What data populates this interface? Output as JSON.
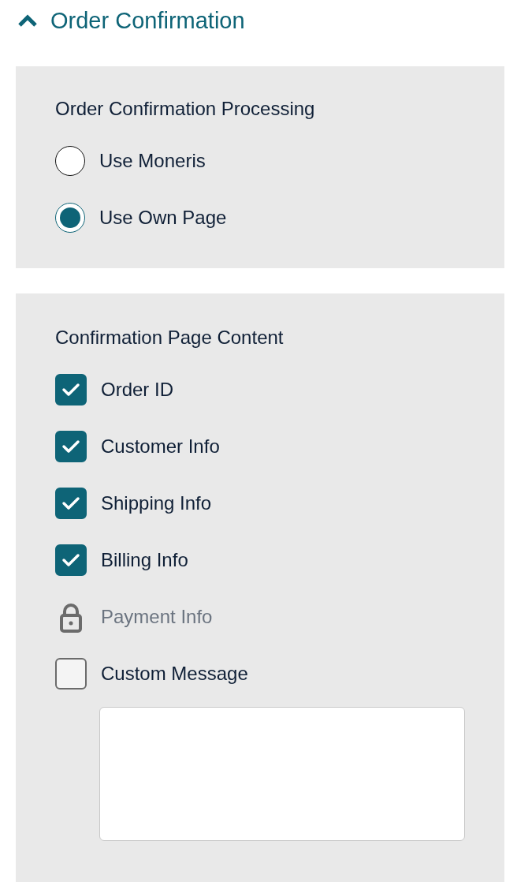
{
  "section": {
    "title": "Order Confirmation",
    "expanded": true
  },
  "processing": {
    "title": "Order Confirmation Processing",
    "options": [
      {
        "label": "Use Moneris",
        "selected": false
      },
      {
        "label": "Use Own Page",
        "selected": true
      }
    ]
  },
  "content": {
    "title": "Confirmation Page Content",
    "items": [
      {
        "kind": "checkbox",
        "label": "Order ID",
        "checked": true
      },
      {
        "kind": "checkbox",
        "label": "Customer Info",
        "checked": true
      },
      {
        "kind": "checkbox",
        "label": "Shipping Info",
        "checked": true
      },
      {
        "kind": "checkbox",
        "label": "Billing Info",
        "checked": true
      },
      {
        "kind": "locked",
        "label": "Payment Info"
      },
      {
        "kind": "checkbox",
        "label": "Custom Message",
        "checked": false
      }
    ]
  }
}
